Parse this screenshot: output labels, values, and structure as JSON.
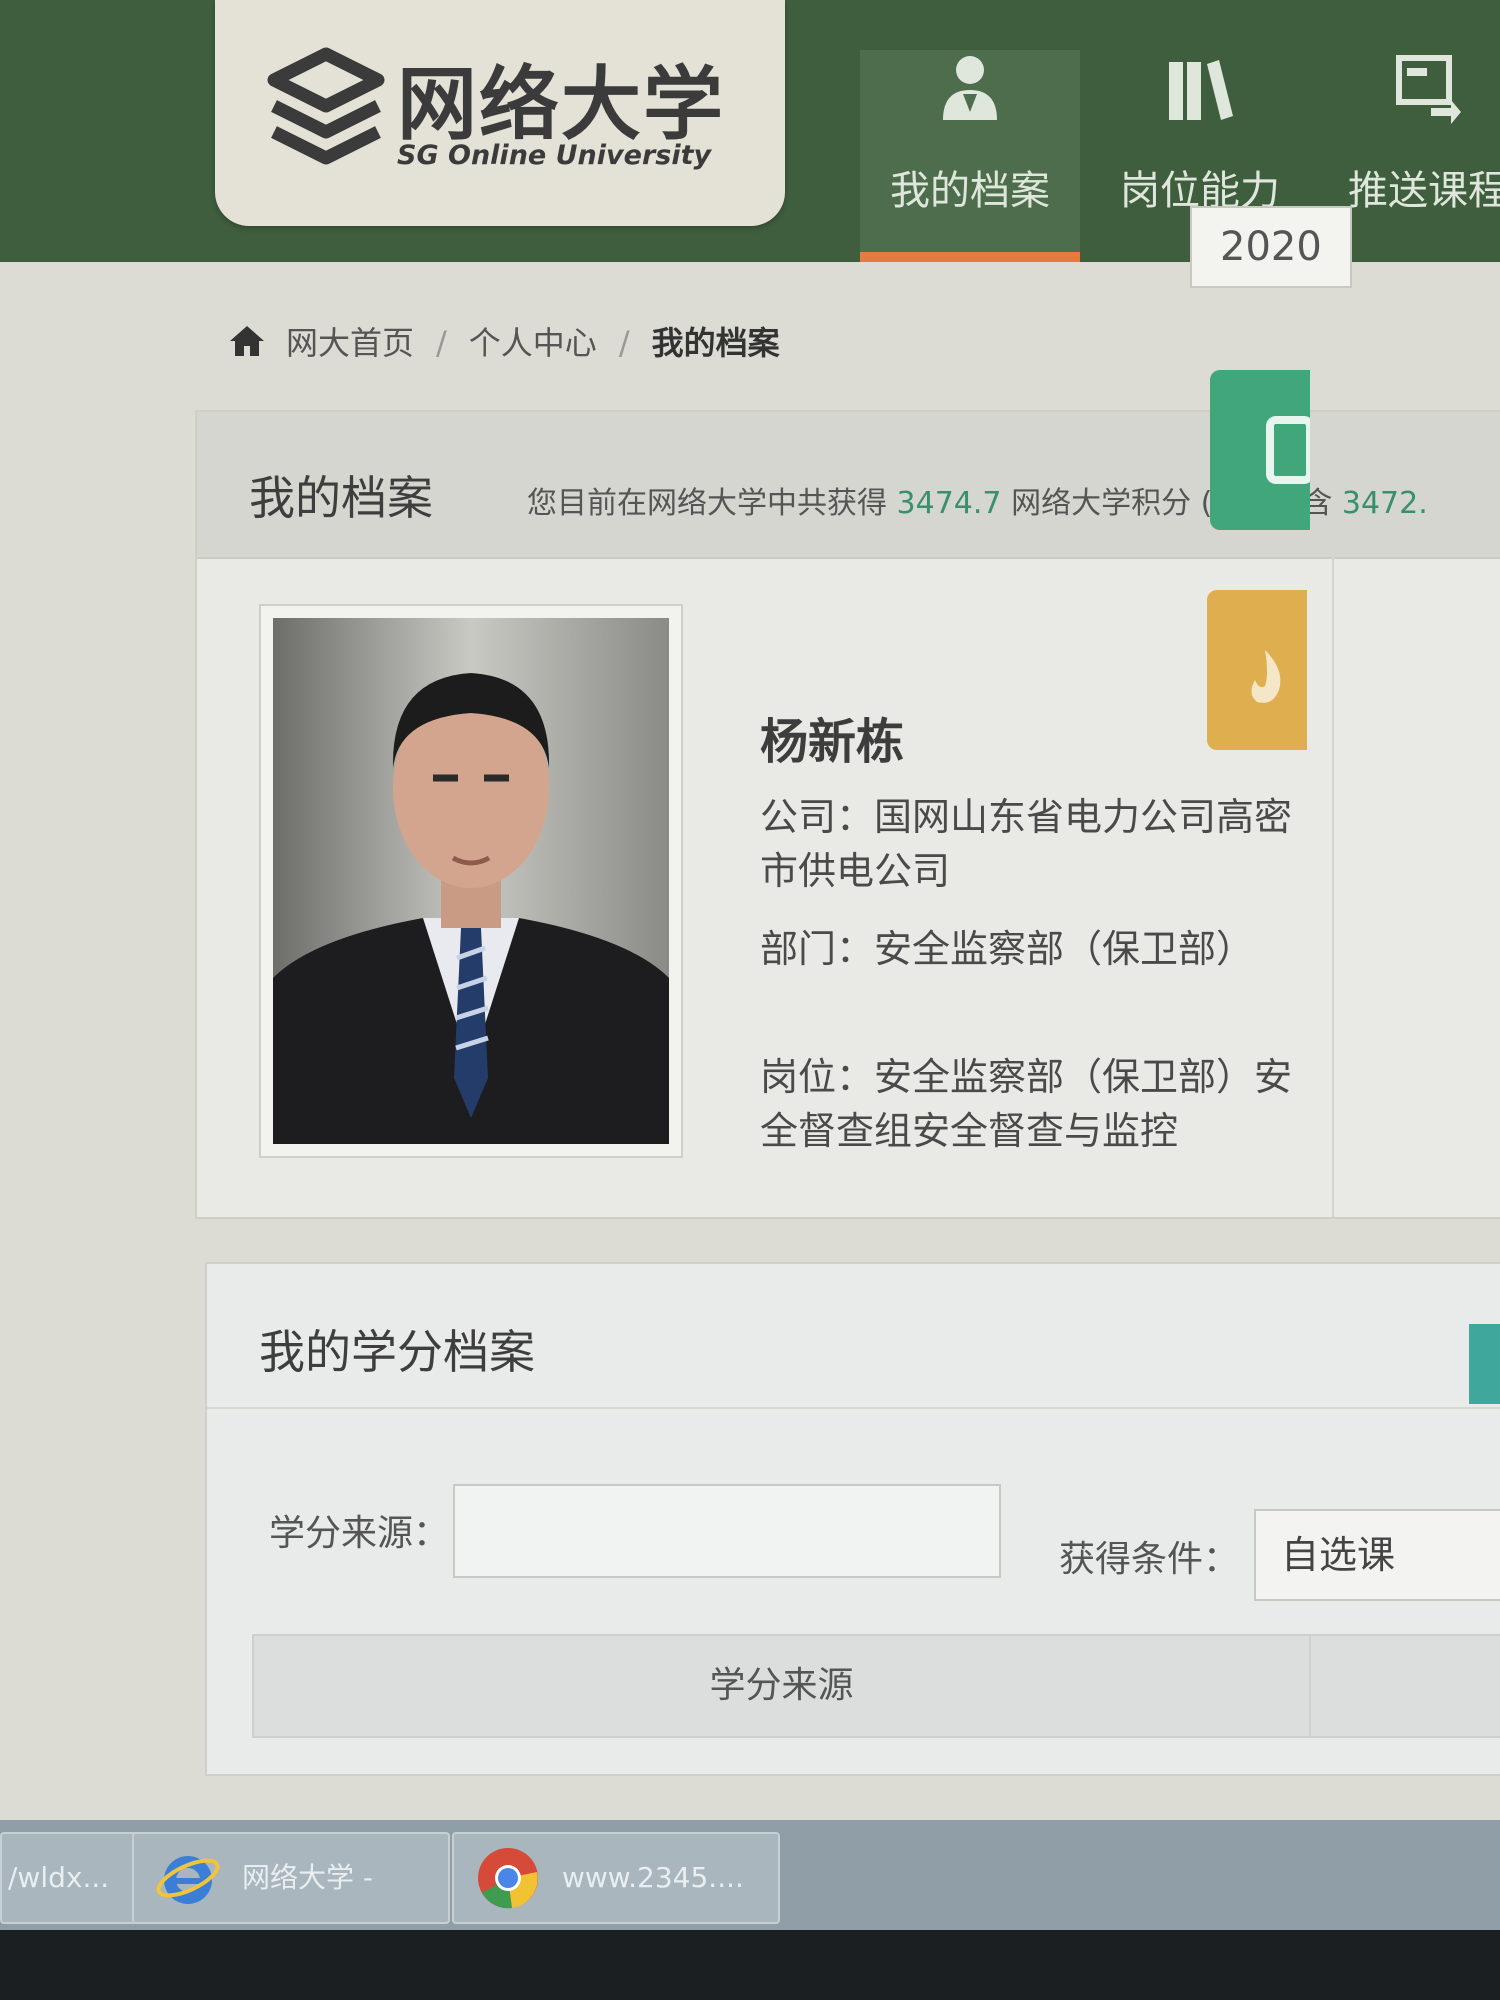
{
  "header": {
    "logo": {
      "cn": "网络大学",
      "en": "SG Online University"
    },
    "nav": [
      {
        "label": "我的档案",
        "icon": "user-profile-icon",
        "active": true
      },
      {
        "label": "岗位能力",
        "icon": "books-icon",
        "active": false
      },
      {
        "label": "推送课程",
        "icon": "push-course-icon",
        "active": false
      }
    ]
  },
  "breadcrumb": {
    "items": [
      "网大首页",
      "个人中心",
      "我的档案"
    ],
    "separators": [
      "/",
      "/"
    ]
  },
  "profile": {
    "title": "我的档案",
    "points_pre": "您目前在网络大学中共获得",
    "points_total": "3474.7",
    "points_mid": "网络大学积分 (其中包含",
    "points_sub": "3472.",
    "name": "杨新栋",
    "company": "公司：国网山东省电力公司高密市供电公司",
    "department": "部门：安全监察部（保卫部）",
    "position": "岗位：安全监察部（保卫部）安全督查组安全督查与监控",
    "year": "2020"
  },
  "credits": {
    "title": "我的学分档案",
    "source_label": "学分来源：",
    "source_value": "",
    "condition_label": "获得条件：",
    "condition_value": "自选课",
    "table_col1": "学分来源"
  },
  "taskbar": {
    "items": [
      {
        "label": "/wldx...",
        "icon": ""
      },
      {
        "label": "网络大学 -",
        "icon": "ie-icon"
      },
      {
        "label": "www.2345....",
        "icon": "chrome-icon"
      }
    ]
  },
  "colors": {
    "header_green": "#3f5e3e",
    "nav_active_underline": "#e77a3f",
    "points_number": "#3a8f6d",
    "tile_green": "#41a67a",
    "tile_yellow": "#dfae4e",
    "teal_tab": "#3fa79c"
  }
}
